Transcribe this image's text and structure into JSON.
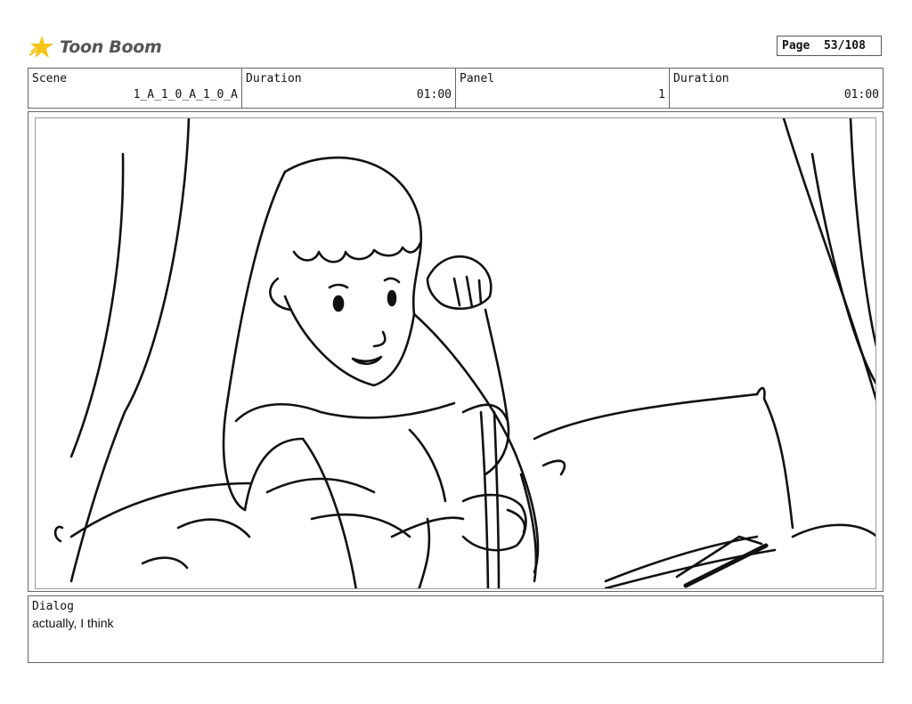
{
  "brand": {
    "name": "Toon Boom",
    "icon": "toon-boom-star-icon",
    "color": "#f5c518"
  },
  "page": {
    "label": "Page",
    "number": "53/108"
  },
  "header": {
    "scene_label": "Scene",
    "scene_value": "1_A_1_0_A_1_0_A",
    "duration_label": "Duration",
    "duration_value": "01:00",
    "panel_label": "Panel",
    "panel_value": "1",
    "panel_duration_label": "Duration",
    "panel_duration_value": "01:00"
  },
  "dialog": {
    "label": "Dialog",
    "text": "actually, I think"
  }
}
